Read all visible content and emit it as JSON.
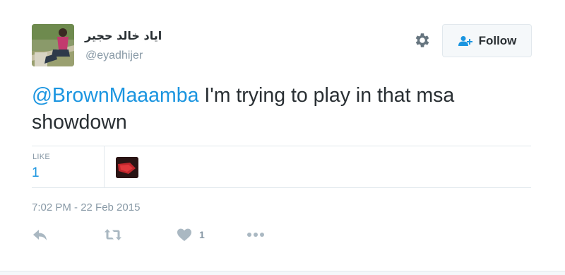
{
  "user": {
    "display_name": "اياد خالد حجير",
    "handle": "@eyadhijer",
    "avatar_icon": "user-photo"
  },
  "header": {
    "settings_icon": "gear-icon",
    "follow_label": "Follow",
    "follow_icon": "add-user-icon"
  },
  "tweet": {
    "mention": "@BrownMaaamba",
    "text": " I'm trying to play in that msa showdown"
  },
  "stats": {
    "like_label": "LIKE",
    "like_count": "1",
    "liker_avatar_icon": "liker-avatar"
  },
  "timestamp": "7:02 PM - 22 Feb 2015",
  "actions": {
    "reply_icon": "reply-icon",
    "retweet_icon": "retweet-icon",
    "like_icon": "heart-icon",
    "like_count": "1",
    "more_icon": "more-icon"
  },
  "colors": {
    "accent": "#1b95e0",
    "muted": "#8899a6",
    "text": "#292f33",
    "border": "#e1e8ed"
  }
}
